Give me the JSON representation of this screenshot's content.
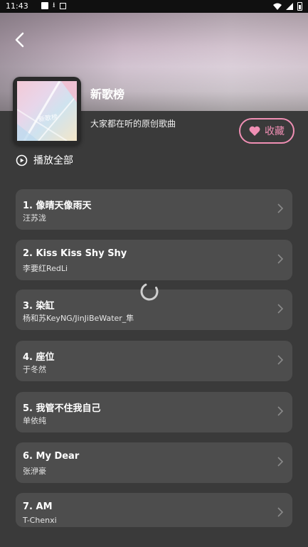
{
  "status_bar": {
    "time": "11:43"
  },
  "header": {
    "title": "新歌榜",
    "subtitle": "大家都在听的原创歌曲",
    "cover_label": "新歌榜",
    "favorite_label": "收藏"
  },
  "play_all_label": "播放全部",
  "songs": [
    {
      "title": "1. 像晴天像雨天",
      "artist": "汪苏泷"
    },
    {
      "title": "2. Kiss Kiss Shy Shy",
      "artist": "李要红RedLi"
    },
    {
      "title": "3. 染缸",
      "artist": "杨和苏KeyNG/JinJiBeWater_隼"
    },
    {
      "title": "4. 座位",
      "artist": "于冬然"
    },
    {
      "title": "5. 我管不住我自己",
      "artist": "单依纯"
    },
    {
      "title": "6. My Dear",
      "artist": "张洢豪"
    },
    {
      "title": "7. AM",
      "artist": "T-Chenxi"
    }
  ],
  "colors": {
    "accent": "#f08fb4",
    "background": "#3a3a3a",
    "card": "#4d4d4d"
  },
  "icons": {
    "back": "chevron-left-icon",
    "favorite": "heart-icon",
    "play_all": "play-circle-icon",
    "row": "chevron-right-icon",
    "loading": "spinner-icon"
  }
}
